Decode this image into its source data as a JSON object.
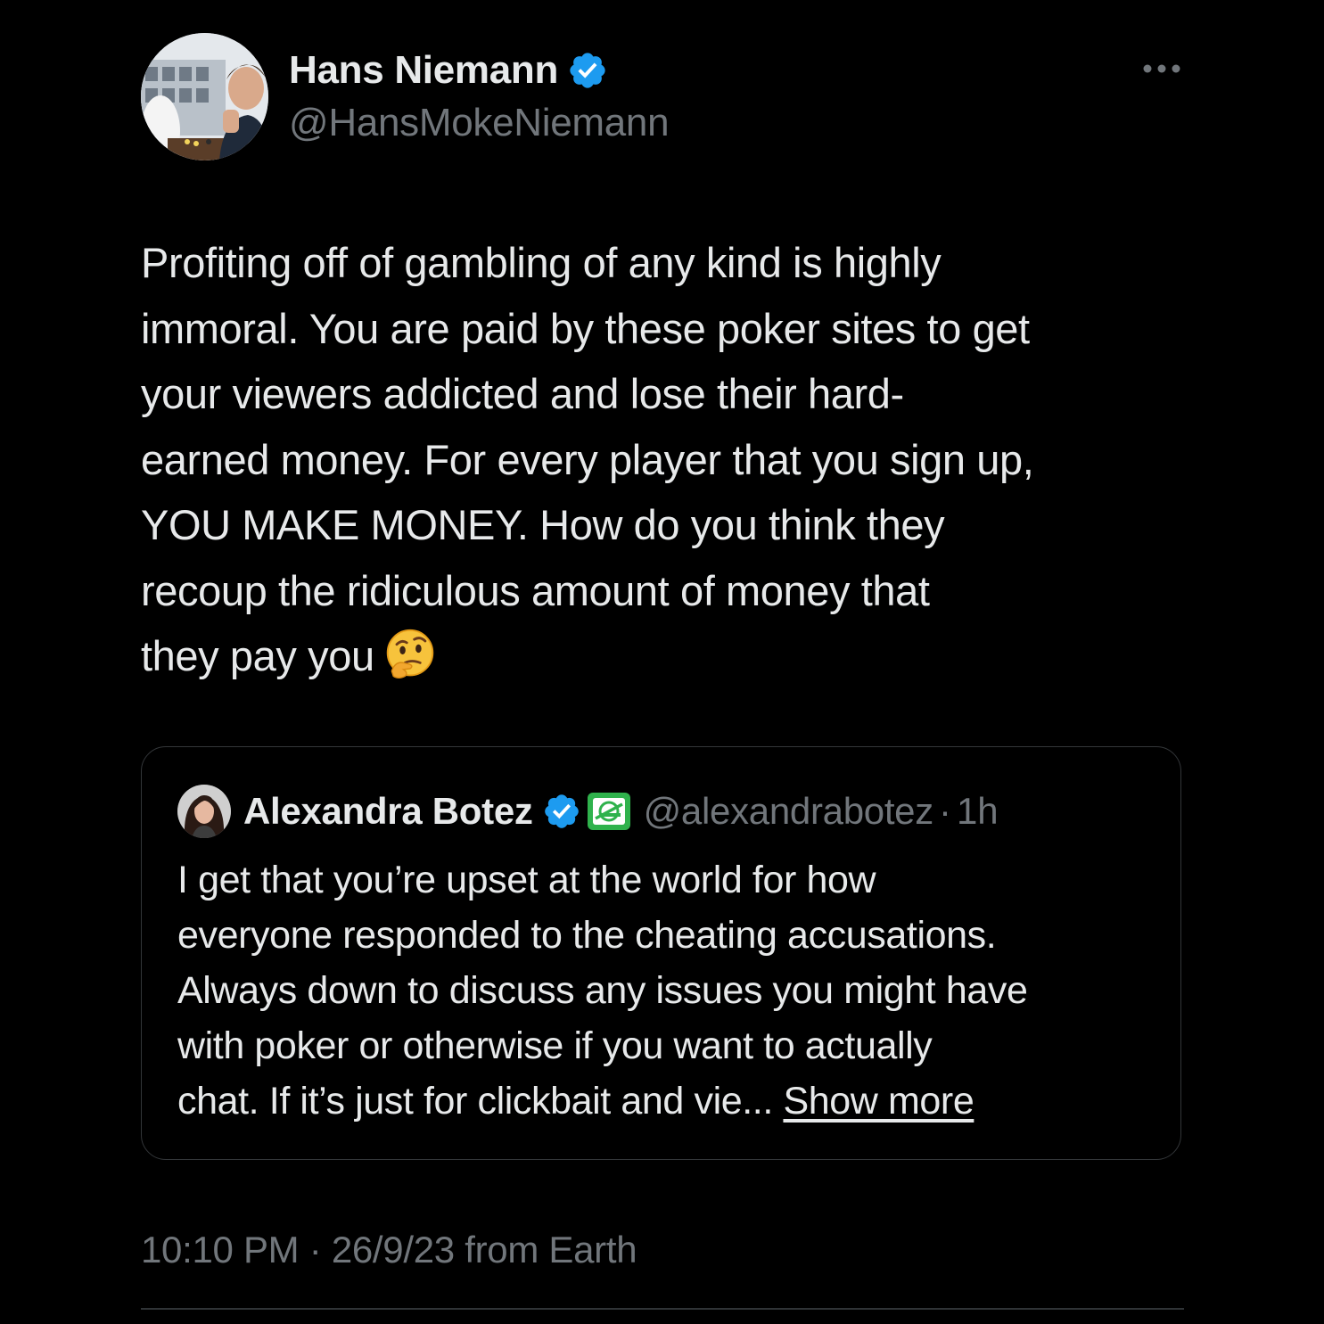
{
  "colors": {
    "background": "#000000",
    "primary_text": "#e7e9ea",
    "secondary_text": "#71767b",
    "verified_blue": "#1d9bf0",
    "border": "#333639",
    "affiliate_green": "#2fb24c"
  },
  "tweet": {
    "author": {
      "name": "Hans Niemann",
      "handle": "@HansMokeNiemann",
      "verified": true,
      "avatar_icon": "profile-photo"
    },
    "more_icon": "ellipsis-icon",
    "text_lines": [
      "Profiting off of gambling of any kind is highly",
      "immoral. You are paid by these poker sites to get",
      "your viewers addicted and lose their hard-",
      "earned money. For every player that you sign up,",
      "YOU MAKE MONEY. How do you think they",
      "recoup the ridiculous amount of money that",
      "they pay you"
    ],
    "emoji": "thinking-face",
    "quote": {
      "author_name": "Alexandra Botez",
      "verified": true,
      "affiliate_badge": "optic-gaming-badge",
      "handle": "@alexandrabotez",
      "separator": "·",
      "time": "1h",
      "text_lines": [
        "I get that you’re upset at the world for how",
        "everyone responded to the cheating accusations.",
        "Always down to discuss any issues you might have",
        "with poker or otherwise if you want to actually",
        "chat. If it’s just for clickbait and vie..."
      ],
      "show_more": "Show more"
    },
    "timestamp": "10:10 PM",
    "separator": "·",
    "date": "26/9/23",
    "source": "from Earth"
  }
}
